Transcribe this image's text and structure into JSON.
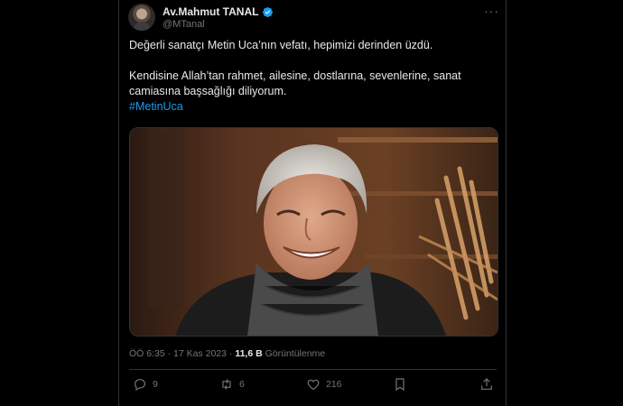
{
  "author": {
    "display_name": "Av.Mahmut TANAL",
    "handle": "@MTanal",
    "verified_icon": "verified-badge-icon"
  },
  "tweet": {
    "line1": "Değerli sanatçı Metin Uca’nın vefatı, hepimizi derinden üzdü.",
    "line2": "Kendisine Allah’tan rahmet, ailesine, dostlarına, sevenlerine, sanat camiasına başsağlığı diliyorum.",
    "hashtag": "#MetinUca"
  },
  "meta": {
    "timestamp": "ÖÖ 6:35 · 17 Kas 2023 · ",
    "views": "11,6 B",
    "views_label": " Görüntülenme"
  },
  "actions": {
    "replies": "9",
    "reposts": "6",
    "likes": "216"
  },
  "colors": {
    "background": "#000000",
    "text": "#e7e9ea",
    "muted": "#71767b",
    "accent": "#1d9bf0"
  }
}
